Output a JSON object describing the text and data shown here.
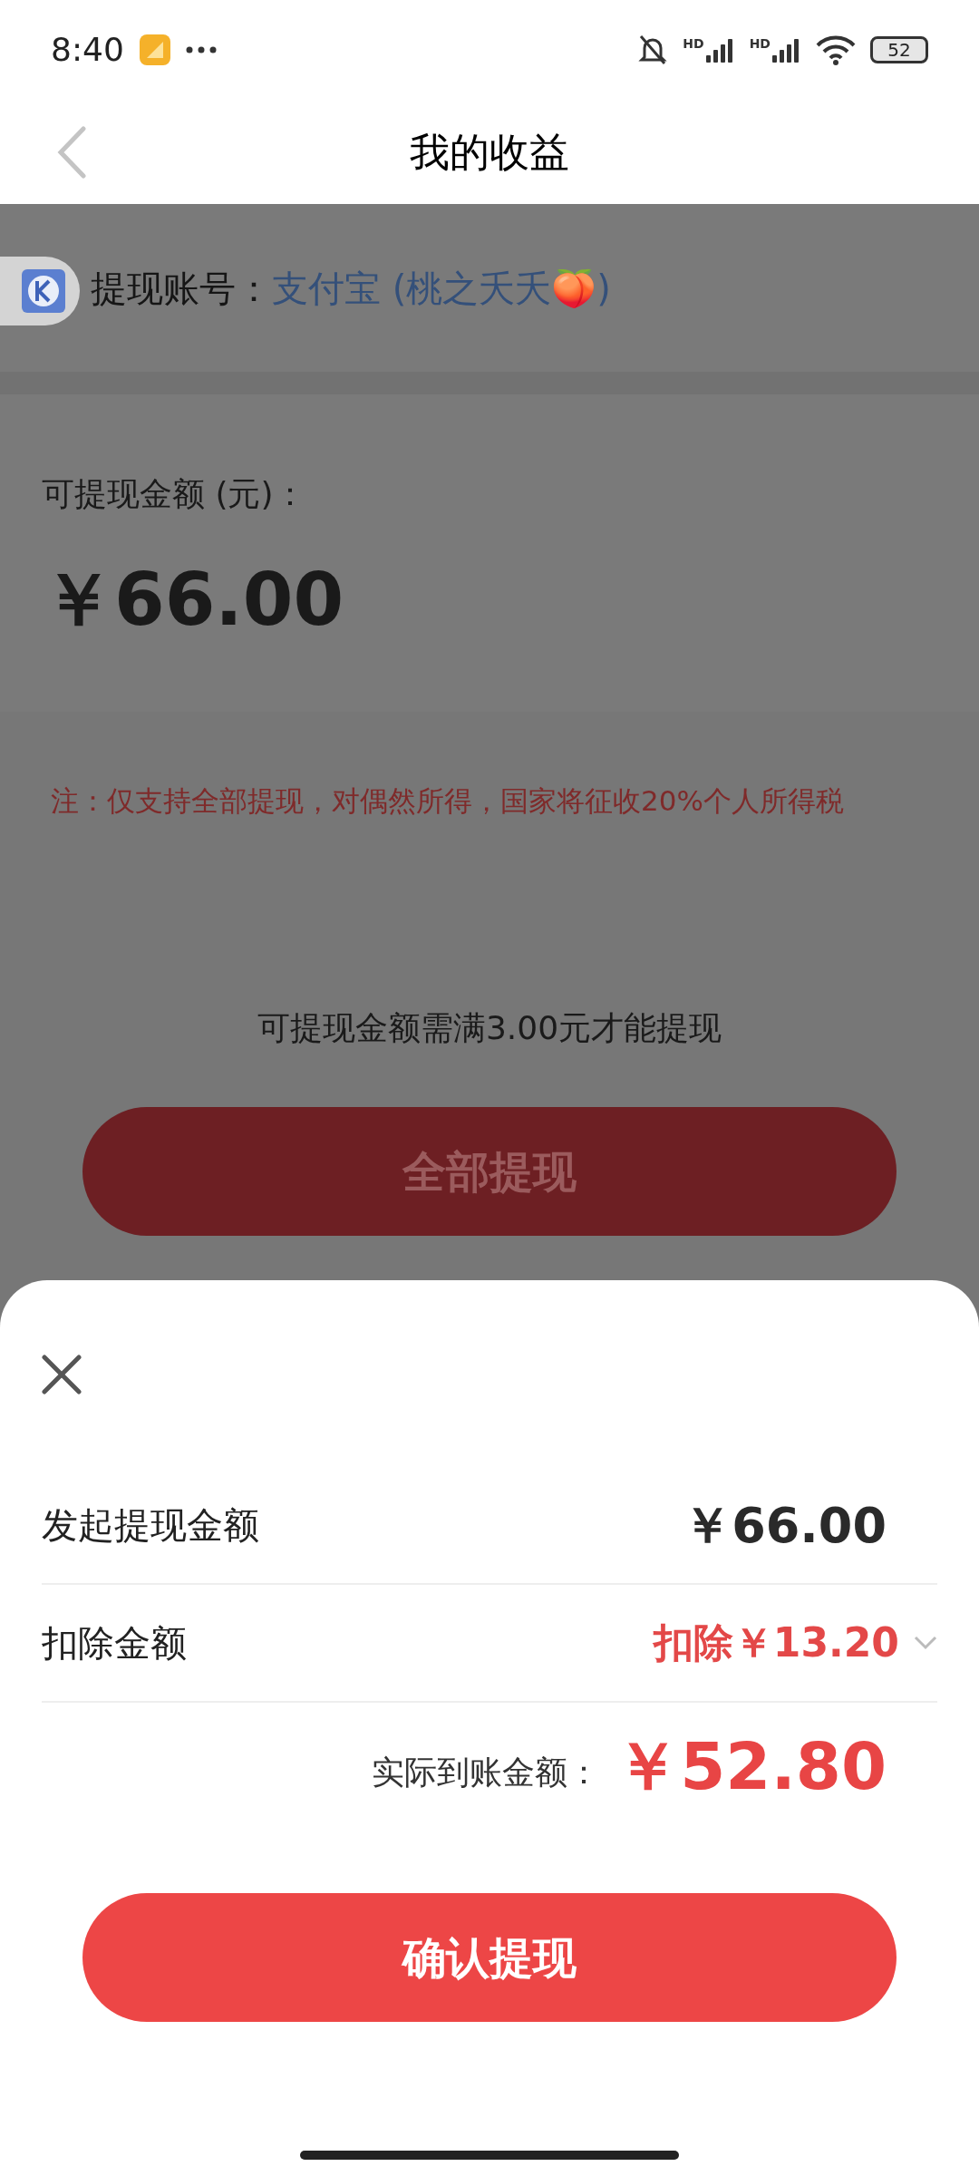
{
  "status_bar": {
    "time": "8:40",
    "signals": [
      {
        "label": "HD"
      },
      {
        "label": "HD"
      }
    ],
    "battery": "52"
  },
  "header": {
    "title": "我的收益"
  },
  "account": {
    "label": "提现账号：",
    "value": "支付宝 (桃之夭夭🍑)"
  },
  "balance": {
    "label": "可提现金额 (元)：",
    "amount": "￥66.00"
  },
  "note": "注：仅支持全部提现，对偶然所得，国家将征收20%个人所得税",
  "minimum_hint": "可提现金额需满3.00元才能提现",
  "withdraw_all_button": "全部提现",
  "sheet": {
    "rows": [
      {
        "kind": "plain",
        "label": "发起提现金额",
        "value": "￥66.00"
      },
      {
        "kind": "expandable",
        "label": "扣除金额",
        "value": "扣除￥13.20",
        "expanded": false
      }
    ],
    "total": {
      "label": "实际到账金额：",
      "value": "￥52.80"
    },
    "confirm_button": "确认提现"
  }
}
